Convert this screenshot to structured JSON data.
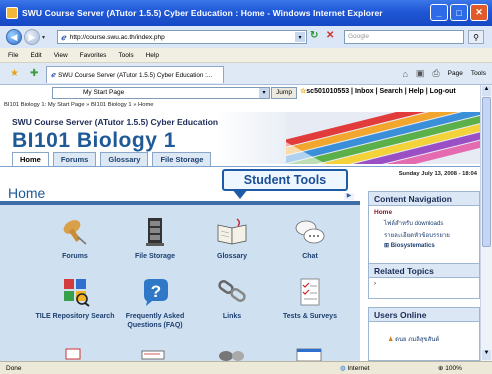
{
  "window": {
    "title": "SWU Course Server (ATutor 1.5.5) Cyber Education : Home - Windows Internet Explorer",
    "controls": [
      "_",
      "□",
      "✕"
    ]
  },
  "browser": {
    "url": "http://course.swu.ac.th/index.php",
    "search_placeholder": "Google",
    "menu": [
      "File",
      "Edit",
      "View",
      "Favorites",
      "Tools",
      "Help"
    ],
    "tab_title": "SWU Course Server (ATutor 1.5.5) Cyber Education :...",
    "tools": {
      "page": "Page",
      "tools": "Tools"
    }
  },
  "site": {
    "jump_select": "My Start Page",
    "jump_button": "Jump",
    "user_links": "sc501010553 | Inbox | Search | Help | Log-out",
    "breadcrumb": "BI101 Biology 1: My Start Page » BI101 Biology 1 » Home",
    "course_server_name": "SWU Course Server (ATutor 1.5.5) Cyber Education",
    "course_title": "BI101 Biology 1",
    "tabs": [
      {
        "label": "Home",
        "active": true
      },
      {
        "label": "Forums",
        "active": false
      },
      {
        "label": "Glossary",
        "active": false
      },
      {
        "label": "File Storage",
        "active": false
      }
    ]
  },
  "main": {
    "heading": "Home",
    "callout": "Student Tools",
    "tools": [
      {
        "label": "Forums",
        "icon": "pushpin-icon"
      },
      {
        "label": "File Storage",
        "icon": "file-cabinet-icon"
      },
      {
        "label": "Glossary",
        "icon": "open-book-icon"
      },
      {
        "label": "Chat",
        "icon": "chat-bubbles-icon"
      },
      {
        "label": "TILE Repository Search",
        "icon": "tile-repository-icon"
      },
      {
        "label": "Frequently Asked Questions (FAQ)",
        "icon": "question-mark-icon"
      },
      {
        "label": "Links",
        "icon": "chain-link-icon"
      },
      {
        "label": "Tests & Surveys",
        "icon": "checklist-icon"
      }
    ]
  },
  "sidebar": {
    "date": "Sunday July 13, 2008 - 18:04",
    "content_navigation": {
      "heading": "Content Navigation",
      "home": "Home",
      "items": [
        {
          "label": "ไฟล์สำหรับ downloads",
          "bold": false,
          "expander": ""
        },
        {
          "label": "รายละเอียดหัวข้อบรรยาย",
          "bold": false,
          "expander": ""
        },
        {
          "label": "Biosystematics",
          "bold": true,
          "expander": "⊞"
        }
      ]
    },
    "related_topics": {
      "heading": "Related Topics",
      "body": "›"
    },
    "users_online": {
      "heading": "Users Online",
      "user": "ดนย ภมลิสุขสันต์"
    }
  },
  "statusbar": {
    "left": "Done",
    "zone": "Internet",
    "zoom": "100%"
  }
}
